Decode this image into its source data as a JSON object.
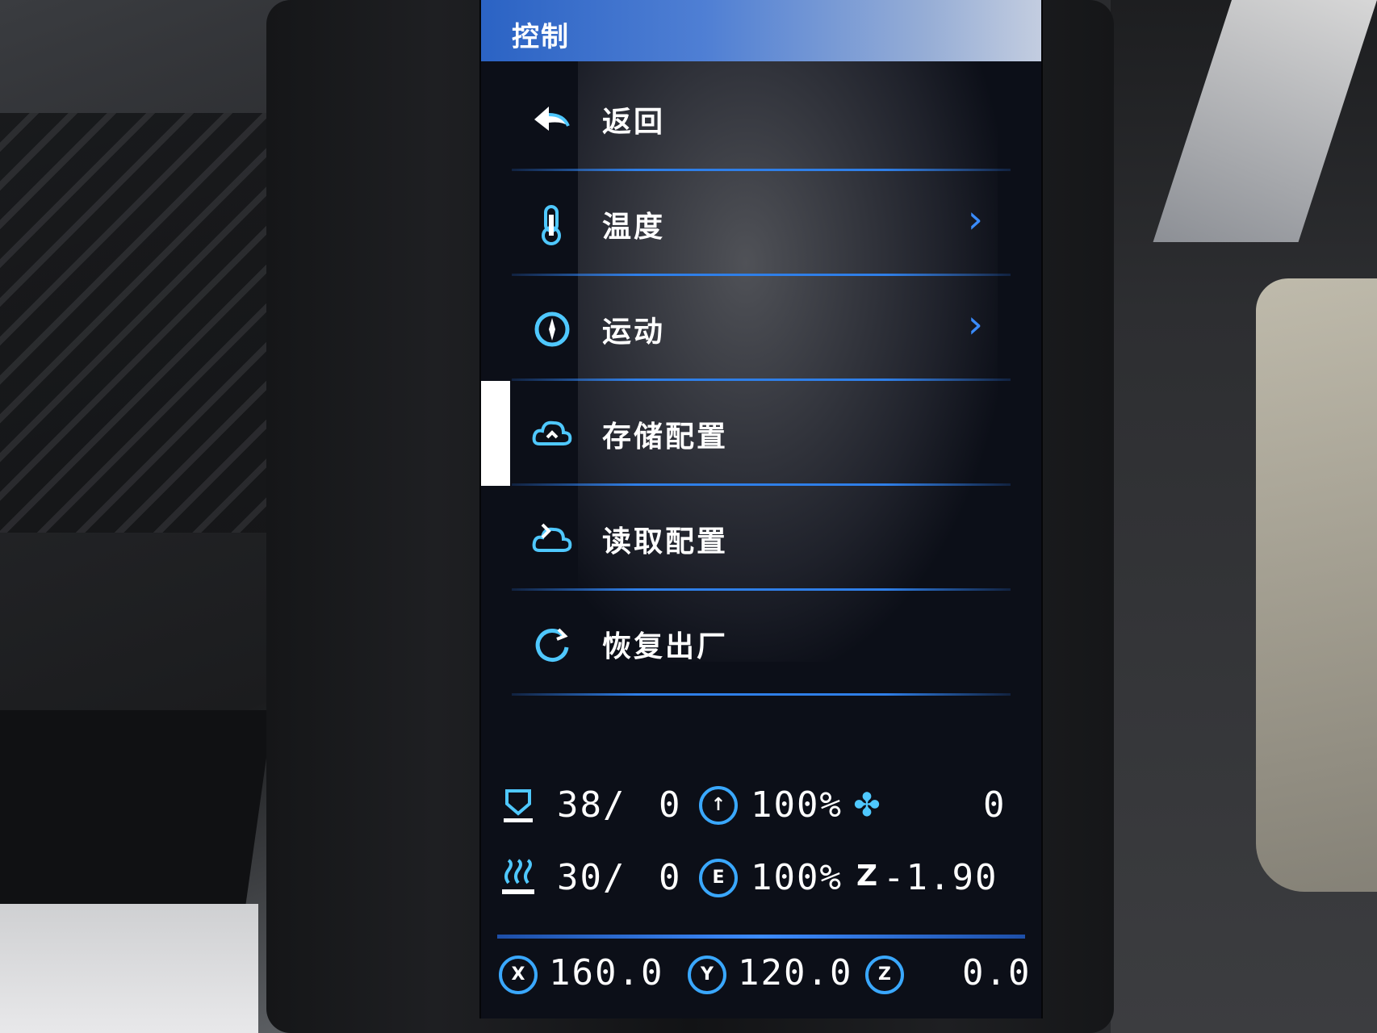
{
  "header": {
    "title": "控制"
  },
  "menu": {
    "items": [
      {
        "label": "返回",
        "icon": "back-arrow-icon",
        "has_submenu": false,
        "selected": false
      },
      {
        "label": "温度",
        "icon": "thermometer-icon",
        "has_submenu": true,
        "selected": false
      },
      {
        "label": "运动",
        "icon": "motion-icon",
        "has_submenu": true,
        "selected": false
      },
      {
        "label": "存储配置",
        "icon": "cloud-save-icon",
        "has_submenu": false,
        "selected": true
      },
      {
        "label": "读取配置",
        "icon": "cloud-load-icon",
        "has_submenu": false,
        "selected": false
      },
      {
        "label": "恢复出厂",
        "icon": "reset-icon",
        "has_submenu": false,
        "selected": false
      }
    ]
  },
  "status": {
    "nozzle_temp": "38/",
    "nozzle_target": "0",
    "bed_temp": "30/",
    "bed_target": "0",
    "speed": "100%",
    "flow": "100%",
    "fan": "0",
    "z_offset": "-1.90",
    "x_pos": "160.0",
    "y_pos": "120.0",
    "z_pos": "0.0",
    "labels": {
      "x": "X",
      "y": "Y",
      "z": "Z",
      "e": "E",
      "z_offset": "Z"
    }
  },
  "colors": {
    "accent": "#3aa8ff",
    "title_bar": "#2b63c4",
    "selection": "#ffffff"
  }
}
